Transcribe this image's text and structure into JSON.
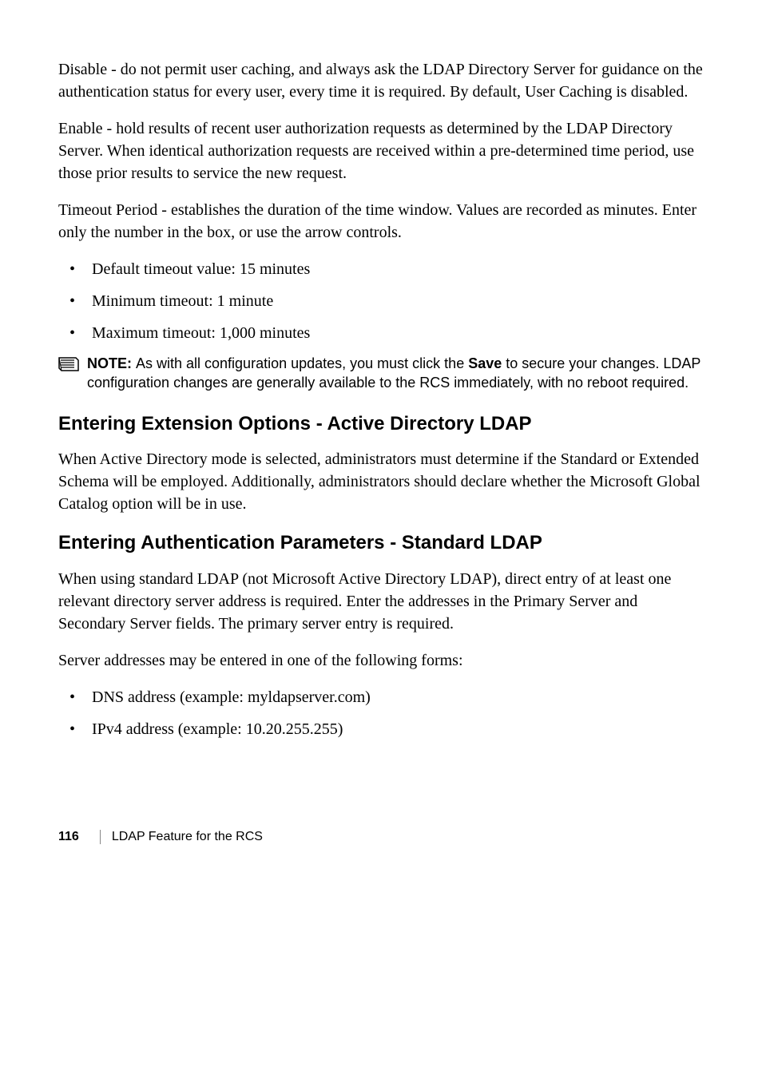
{
  "paragraphs": {
    "p1": "Disable - do not permit user caching, and always ask the LDAP Directory Server for guidance on the authentication status for every user, every time it is required. By default, User Caching is disabled.",
    "p2": "Enable - hold results of recent user authorization requests as determined by the LDAP Directory Server. When identical authorization requests are received within a pre-determined time period, use those prior results to service the new request.",
    "p3": "Timeout Period - establishes the duration of the time window. Values are recorded as minutes. Enter only the number in the box, or use the arrow controls."
  },
  "bullets1": {
    "b1": "Default timeout value: 15 minutes",
    "b2": "Minimum timeout: 1 minute",
    "b3": "Maximum timeout: 1,000 minutes"
  },
  "note": {
    "label": "NOTE: ",
    "pre": "As with all configuration updates, you must click the ",
    "bold": "Save",
    "post": " to secure your changes. LDAP configuration changes are generally available to the RCS immediately, with no reboot required."
  },
  "heading1": "Entering Extension Options - Active Directory LDAP",
  "paragraphs2": {
    "p1": "When Active Directory mode is selected, administrators must determine if the Standard or Extended Schema will be employed. Additionally, administrators should declare whether the Microsoft Global Catalog option will be in use."
  },
  "heading2": "Entering Authentication Parameters - Standard LDAP",
  "paragraphs3": {
    "p1": "When using standard LDAP (not Microsoft Active Directory LDAP), direct entry of at least one relevant directory server address is required. Enter the addresses in the Primary Server and Secondary Server fields. The primary server entry is required.",
    "p2": "Server addresses may be entered in one of the following forms:"
  },
  "bullets2": {
    "b1": "DNS address (example: myldapserver.com)",
    "b2": "IPv4 address (example: 10.20.255.255)"
  },
  "footer": {
    "page": "116",
    "text": "LDAP Feature for the RCS"
  }
}
